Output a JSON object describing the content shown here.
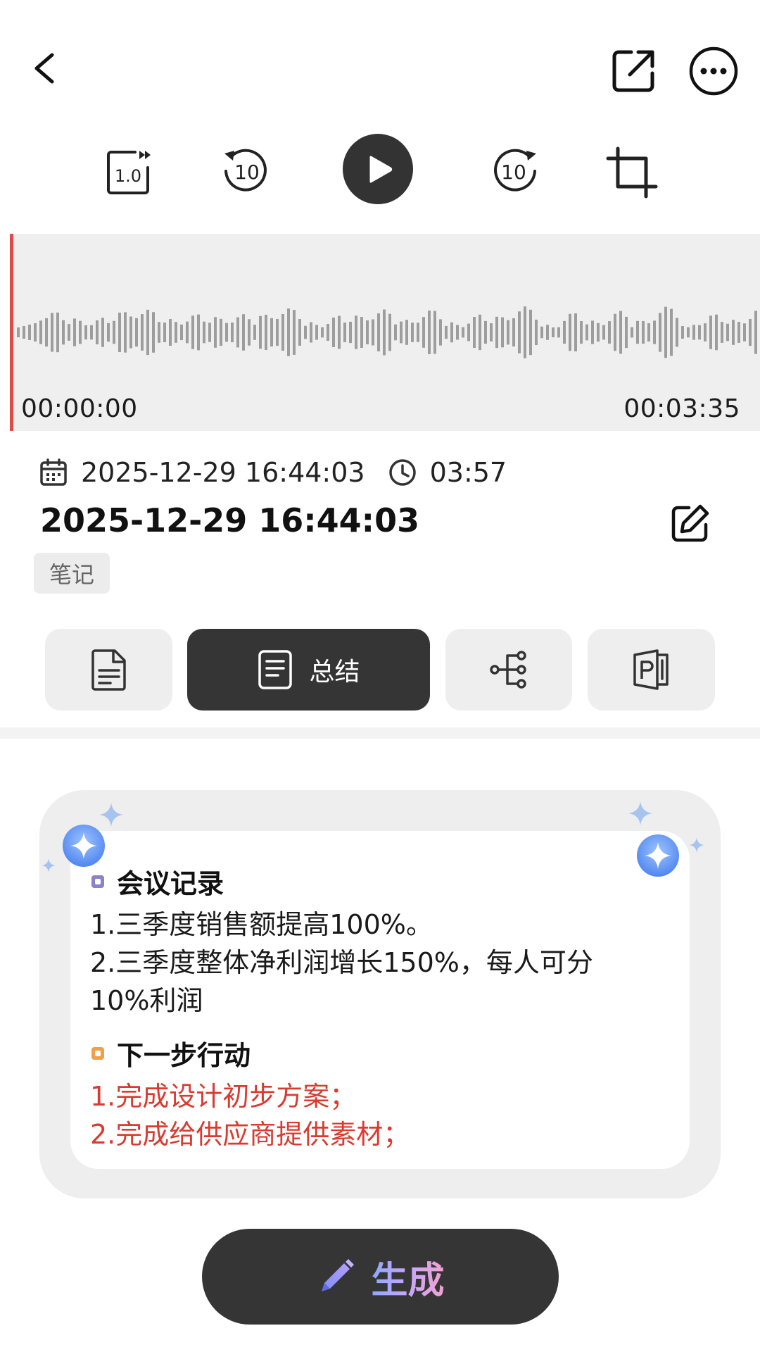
{
  "player": {
    "speed_label": "1.0",
    "rewind_seconds": "10",
    "forward_seconds": "10"
  },
  "waveform": {
    "start_time": "00:00:00",
    "end_time": "00:03:35"
  },
  "recording": {
    "date_time": "2025-12-29 16:44:03",
    "duration": "03:57",
    "title": "2025-12-29 16:44:03",
    "tag": "笔记"
  },
  "tabs": {
    "summary_label": "总结"
  },
  "summary": {
    "section1_title": "会议记录",
    "section1_lines": [
      "1.三季度销售额提高100%。",
      "2.三季度整体净利润增长150%，每人可分",
      "10%利润"
    ],
    "section2_title": "下一步行动",
    "section2_lines": [
      "1.完成设计初步方案；",
      "2.完成给供应商提供素材；"
    ]
  },
  "generate_button": {
    "label": "生成"
  },
  "colors": {
    "accent_dark": "#353535",
    "playhead": "#e04a47",
    "action_red": "#d93b30",
    "bullet_purple": "#8b82c9",
    "bullet_orange": "#f0a04b",
    "sparkle_blue": "#6fa2f5"
  }
}
